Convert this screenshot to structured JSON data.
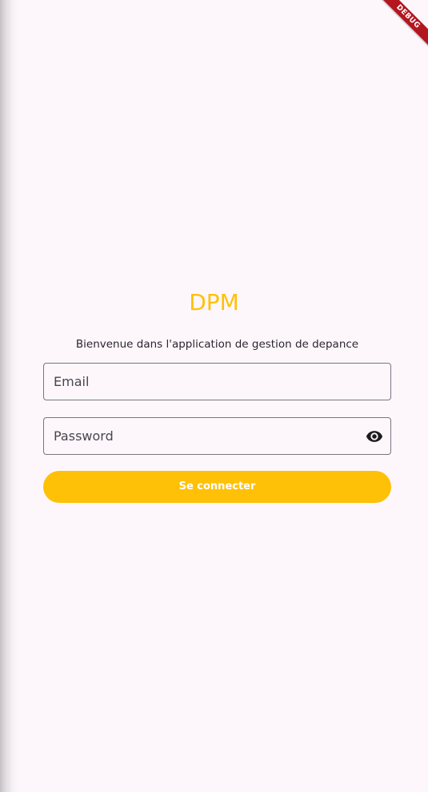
{
  "app": {
    "title": "DPM",
    "subtitle": "Bienvenue dans l'application de gestion de depance",
    "accent_color": "#ffc107",
    "background_color": "#fdf7fc"
  },
  "debug_banner": {
    "label": "DEBUG",
    "color": "#b3161f"
  },
  "form": {
    "email": {
      "label": "Email",
      "value": ""
    },
    "password": {
      "label": "Password",
      "value": "",
      "toggle_icon": "eye-icon"
    },
    "submit_label": "Se connecter"
  }
}
